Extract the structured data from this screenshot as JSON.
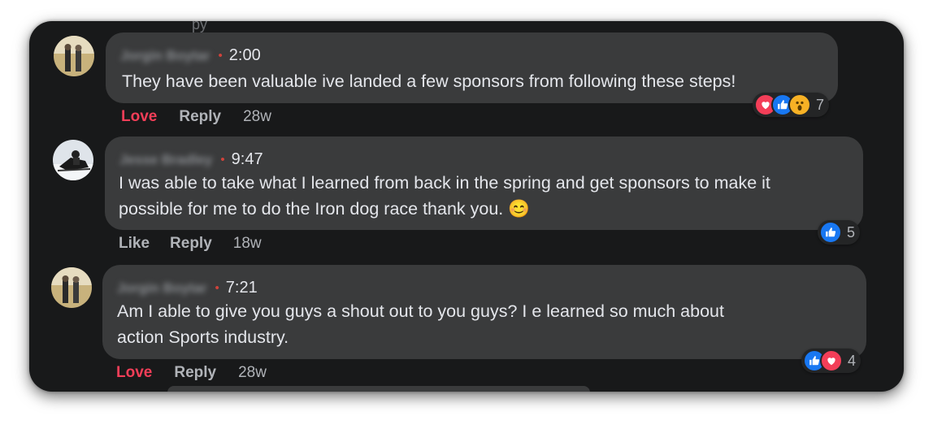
{
  "top_fragment": "py",
  "comments": [
    {
      "author": "Jorgin Boytar",
      "time": "2:00",
      "text_lines": [
        "They have been valuable ive landed a few sponsors from following these steps!"
      ],
      "actions": {
        "react": "Love",
        "reply": "Reply",
        "age": "28w"
      },
      "reactions": {
        "icons": [
          "love-icon",
          "like-icon",
          "wow-icon"
        ],
        "count": "7"
      }
    },
    {
      "author": "Jesse Bradley",
      "time": "9:47",
      "text_lines": [
        "I was able to take what I learned from back in the spring and get sponsors to make it",
        "possible for me to do the Iron dog race thank you. 😊"
      ],
      "actions": {
        "react": "Like",
        "reply": "Reply",
        "age": "18w"
      },
      "reactions": {
        "icons": [
          "like-icon"
        ],
        "count": "5"
      }
    },
    {
      "author": "Jorgin Boytar",
      "time": "7:21",
      "text_lines": [
        "Am I able to give you guys a shout out to you guys? I e learned so much about",
        "action Sports industry."
      ],
      "actions": {
        "react": "Love",
        "reply": "Reply",
        "age": "28w"
      },
      "reactions": {
        "icons": [
          "like-icon",
          "love-icon"
        ],
        "count": "4"
      }
    }
  ],
  "colors": {
    "background": "#18191a",
    "bubble": "#3a3b3c",
    "text": "#e4e6eb",
    "secondary": "#b0b3b8",
    "love": "#f33e58",
    "like": "#1877f2",
    "wow": "#f7b125"
  }
}
